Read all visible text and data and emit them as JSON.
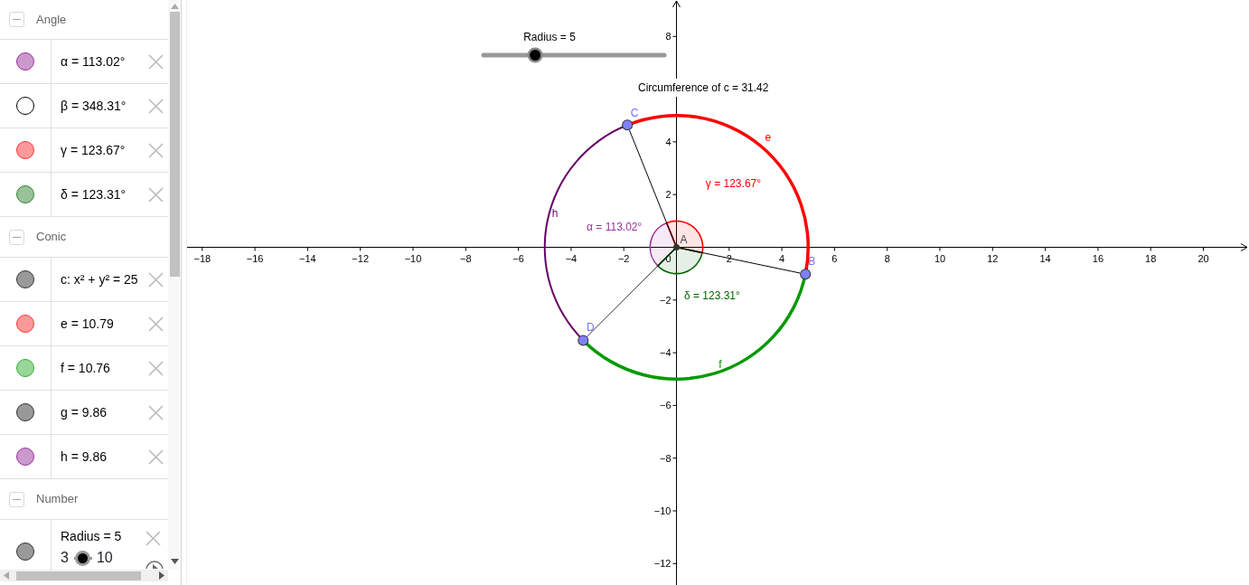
{
  "algebra": {
    "groups": [
      {
        "title": "Angle",
        "expanded": true,
        "items": [
          {
            "kind": "value",
            "text": "α = 113.02°",
            "visible": true,
            "color": "#cc99cc"
          },
          {
            "kind": "value",
            "text": "β = 348.31°",
            "visible": false
          },
          {
            "kind": "value",
            "text": "γ = 123.67°",
            "visible": true,
            "color": "#ff9999"
          },
          {
            "kind": "value",
            "text": "δ = 123.31°",
            "visible": true,
            "color": "#99c299"
          }
        ]
      },
      {
        "title": "Conic",
        "expanded": true,
        "items": [
          {
            "kind": "value",
            "text": "c: x² + y² = 25",
            "visible": true,
            "color": "#999999"
          },
          {
            "kind": "value",
            "text": "e = 10.79",
            "visible": true,
            "color": "#ff9999"
          },
          {
            "kind": "value",
            "text": "f = 10.76",
            "visible": true,
            "color": "#99d699"
          },
          {
            "kind": "value",
            "text": "g = 9.86",
            "visible": true,
            "color": "#999999"
          },
          {
            "kind": "value",
            "text": "h = 9.86",
            "visible": true,
            "color": "#cc99cc"
          }
        ]
      },
      {
        "title": "Number",
        "expanded": true,
        "items": [
          {
            "kind": "slider",
            "text": "Radius = 5",
            "visible": true,
            "color": "#999999",
            "min": "3",
            "max": "10",
            "level": 0.2857
          }
        ]
      }
    ]
  },
  "graphics": {
    "slider": {
      "label": "Radius = 5",
      "level": 0.2857
    },
    "caption": "Circumference of c = 31.42",
    "x_ticks": [
      "−18",
      "−16",
      "−14",
      "−12",
      "−10",
      "−8",
      "−6",
      "−4",
      "−2",
      "2",
      "4",
      "6",
      "8",
      "10",
      "12",
      "14",
      "16",
      "18",
      "20"
    ],
    "origin_label": "0",
    "y_ticks": [
      "8",
      "4",
      "2",
      "−2",
      "−4",
      "−6",
      "−8",
      "−10",
      "−12"
    ],
    "points": [
      {
        "label": "A",
        "kind": "center"
      },
      {
        "label": "B",
        "kind": "free"
      },
      {
        "label": "C",
        "kind": "free"
      },
      {
        "label": "D",
        "kind": "free"
      }
    ],
    "arcs": [
      {
        "label": "e",
        "color": "#ff0000"
      },
      {
        "label": "f",
        "color": "#009900"
      },
      {
        "label": "h",
        "color": "#660066"
      }
    ],
    "angles": [
      {
        "label": "α = 113.02°",
        "color": "#993399"
      },
      {
        "label": "γ = 123.67°",
        "color": "#ff0000"
      },
      {
        "label": "δ = 123.31°",
        "color": "#006600"
      }
    ]
  }
}
